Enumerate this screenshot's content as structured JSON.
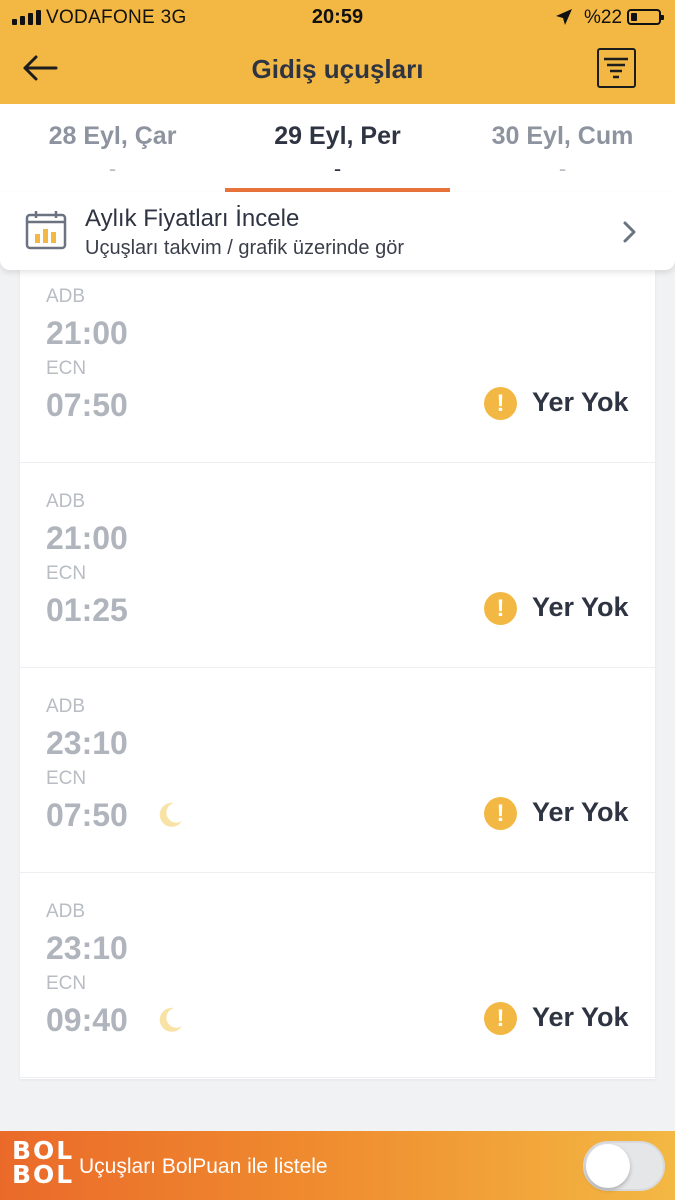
{
  "status_bar": {
    "carrier": "VODAFONE  3G",
    "time": "20:59",
    "battery": "%22",
    "battery_level": 0.22
  },
  "header": {
    "title": "Gidiş uçuşları",
    "back_icon": "arrow-left-icon",
    "filter_icon": "filter-icon"
  },
  "date_tabs": [
    {
      "date": "28 Eyl, Çar",
      "price": "-",
      "selected": false
    },
    {
      "date": "29 Eyl, Per",
      "price": "-",
      "selected": true
    },
    {
      "date": "30 Eyl, Cum",
      "price": "-",
      "selected": false
    }
  ],
  "monthly_prices": {
    "title": "Aylık Fiyatları İncele",
    "subtitle": "Uçuşları takvim / grafik üzerinde gör",
    "icon": "calendar-chart-icon"
  },
  "flights": [
    {
      "from": "ADB",
      "dep": "21:00",
      "to": "ECN",
      "arr": "07:50",
      "night": false,
      "status": "Yer Yok"
    },
    {
      "from": "ADB",
      "dep": "21:00",
      "to": "ECN",
      "arr": "01:25",
      "night": false,
      "status": "Yer Yok"
    },
    {
      "from": "ADB",
      "dep": "23:10",
      "to": "ECN",
      "arr": "07:50",
      "night": true,
      "status": "Yer Yok"
    },
    {
      "from": "ADB",
      "dep": "23:10",
      "to": "ECN",
      "arr": "09:40",
      "night": true,
      "status": "Yer Yok"
    }
  ],
  "warning_glyph": "!",
  "bolpuan": {
    "logo_top": "BOL",
    "logo_bottom": "BOL",
    "label": "Uçuşları BolPuan ile listele",
    "toggle_on": false
  },
  "colors": {
    "brand_yellow": "#f3b843",
    "accent_orange": "#e8743b",
    "text_dark": "#2e3442"
  }
}
